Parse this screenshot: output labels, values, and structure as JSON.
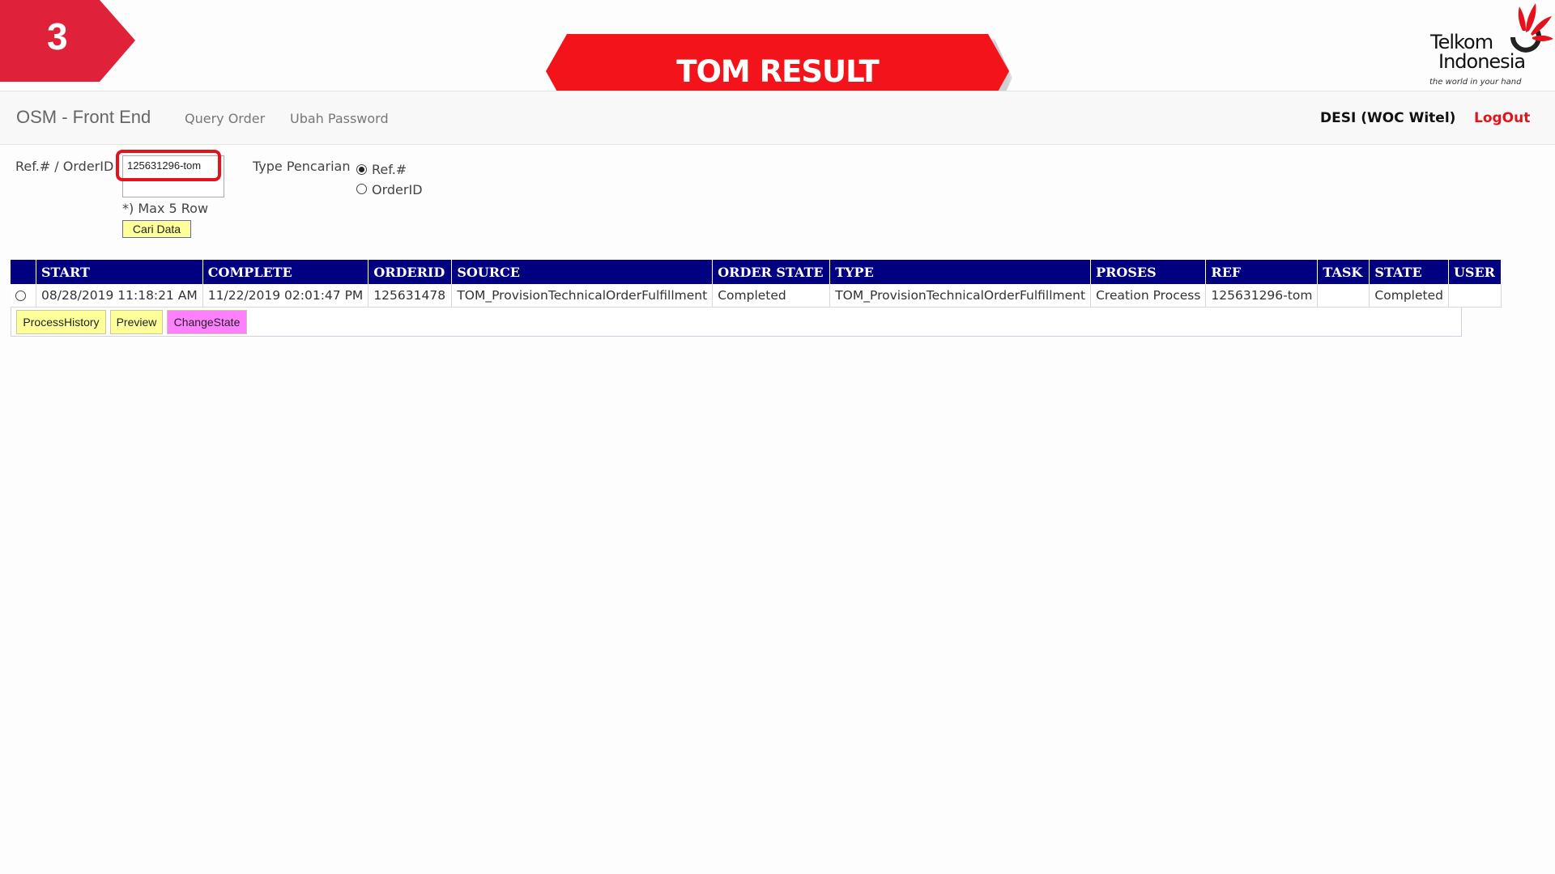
{
  "step_number": "3",
  "banner_title": "TOM RESULT",
  "logo": {
    "line1": "Telkom",
    "line2": "Indonesia",
    "tagline": "the world in your hand"
  },
  "navbar": {
    "brand": "OSM - Front End",
    "links": [
      "Query Order",
      "Ubah Password"
    ],
    "user": "DESI (WOC Witel)",
    "logout": "LogOut"
  },
  "search": {
    "ref_label": "Ref.# / OrderID",
    "input_value": "125631296-tom",
    "max_note": "*) Max 5 Row",
    "submit_label": "Cari Data",
    "type_label": "Type Pencarian",
    "options": [
      {
        "label": "Ref.#",
        "checked": true
      },
      {
        "label": "OrderID",
        "checked": false
      }
    ]
  },
  "table": {
    "headers": [
      "",
      "START",
      "COMPLETE",
      "ORDERID",
      "SOURCE",
      "ORDER STATE",
      "TYPE",
      "PROSES",
      "REF",
      "TASK",
      "STATE",
      "USER"
    ],
    "rows": [
      {
        "start": "08/28/2019 11:18:21 AM",
        "complete": "11/22/2019 02:01:47 PM",
        "orderid": "125631478",
        "source": "TOM_ProvisionTechnicalOrderFulfillment",
        "order_state": "Completed",
        "type": "TOM_ProvisionTechnicalOrderFulfillment",
        "proses": "Creation Process",
        "ref": "125631296-tom",
        "task": "",
        "state": "Completed",
        "user": ""
      }
    ],
    "actions": [
      "ProcessHistory",
      "Preview",
      "ChangeState"
    ]
  },
  "colors": {
    "accent_red": "#f2141a",
    "header_navy": "#000080",
    "button_yellow": "#ffff99",
    "button_magenta": "#ff80ff"
  }
}
